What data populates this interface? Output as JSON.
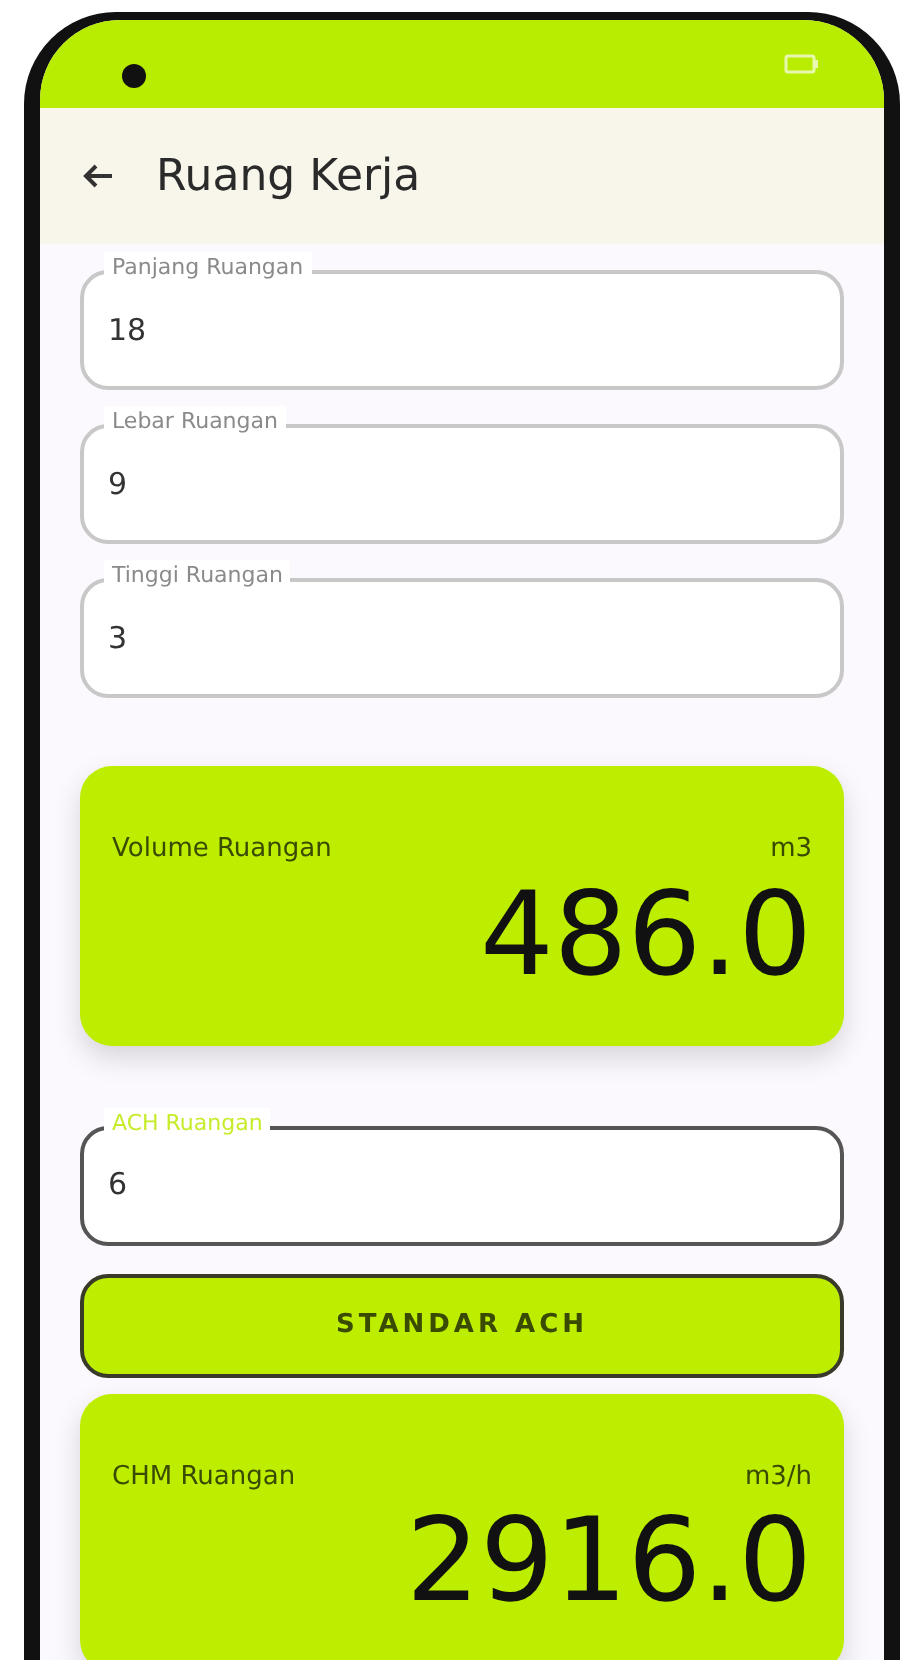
{
  "app_bar": {
    "title": "Ruang Kerja"
  },
  "dimension_fields": [
    {
      "label": "Panjang Ruangan",
      "value": "18",
      "focused": false
    },
    {
      "label": "Lebar Ruangan",
      "value": "9",
      "focused": false
    },
    {
      "label": "Tinggi Ruangan",
      "value": "3",
      "focused": false
    }
  ],
  "volume_card": {
    "label": "Volume Ruangan",
    "unit": "m3",
    "value": "486.0"
  },
  "ach_field": {
    "label": "ACH Ruangan",
    "value": "6",
    "focused": true
  },
  "standard_button": {
    "label": "STANDAR ACH"
  },
  "chm_card": {
    "label": "CHM Ruangan",
    "unit": "m3/h",
    "value": "2916.0"
  }
}
